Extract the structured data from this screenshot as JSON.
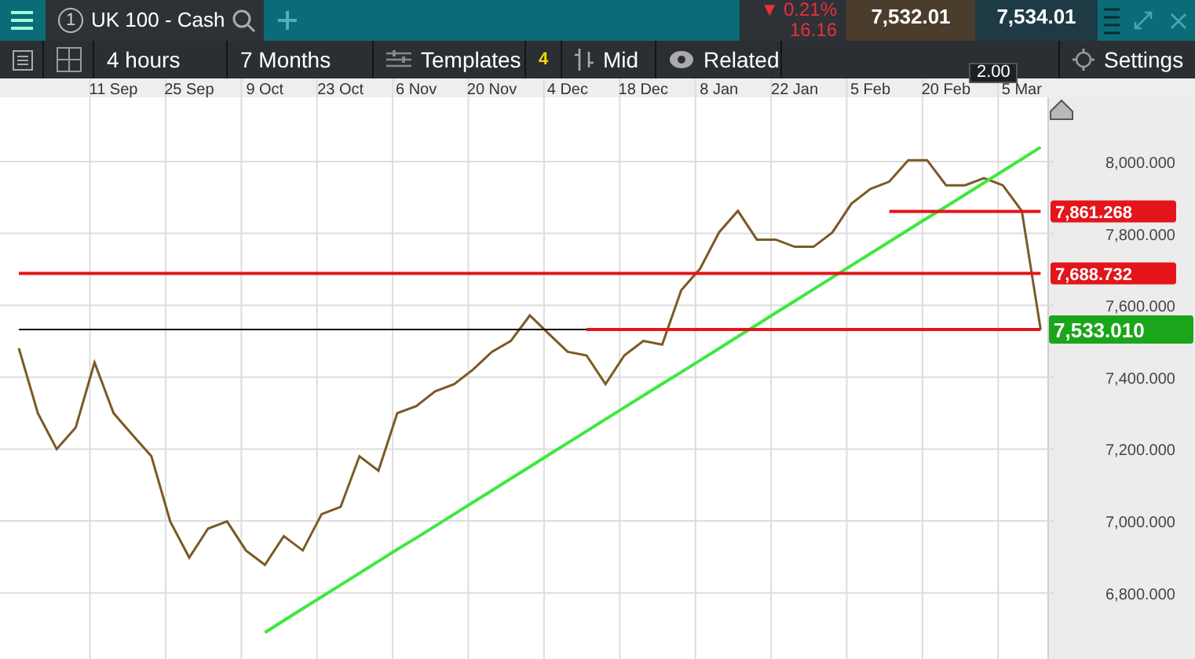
{
  "header": {
    "tab": {
      "number": "1",
      "title": "UK 100 - Cash",
      "selected": true
    },
    "change": {
      "arrow": "▼",
      "percent": "0.21%",
      "points": "16.16"
    },
    "bid": "7,532.01",
    "ask": "7,534.01",
    "spread": "2.00"
  },
  "toolbar": {
    "interval": "4 hours",
    "range": "7 Months",
    "templates": "Templates",
    "templates_count": "4",
    "price_type": "Mid",
    "related": "Related",
    "settings": "Settings"
  },
  "chart": {
    "chart_data": {
      "type": "line",
      "categories": [
        null,
        null,
        null,
        null,
        null,
        "11 Sep",
        null,
        null,
        null,
        "25 Sep",
        null,
        null,
        null,
        "9 Oct",
        null,
        null,
        null,
        "23 Oct",
        null,
        null,
        null,
        "6 Nov",
        null,
        null,
        null,
        "20 Nov",
        null,
        null,
        null,
        "4 Dec",
        null,
        null,
        null,
        "18 Dec",
        null,
        null,
        null,
        "8 Jan",
        null,
        null,
        null,
        "22 Jan",
        null,
        null,
        null,
        "5 Feb",
        null,
        null,
        null,
        "20 Feb",
        null,
        null,
        null,
        "5 Mar",
        null
      ],
      "grid": true,
      "series": [
        {
          "color": "#7a5a24",
          "values": [
            7481,
            7300,
            7200,
            7260,
            7441,
            7300,
            7240,
            7180,
            6999,
            6898,
            6979,
            6999,
            6918,
            6878,
            6958,
            6918,
            7019,
            7039,
            7180,
            7140,
            7300,
            7320,
            7361,
            7381,
            7421,
            7471,
            7501,
            7572,
            7521,
            7471,
            7461,
            7381,
            7461,
            7501,
            7491,
            7642,
            7702,
            7803,
            7863,
            7783,
            7783,
            7763,
            7763,
            7803,
            7883,
            7924,
            7944,
            8004,
            8004,
            7934,
            7934,
            7954,
            7934,
            7863,
            7533
          ]
        },
        {
          "color": "#3ee83e",
          "values": [
            null,
            null,
            null,
            null,
            null,
            null,
            null,
            null,
            null,
            null,
            null,
            null,
            null,
            6690,
            6723,
            6756,
            6789,
            6822,
            6855,
            6888,
            6921,
            6953,
            6986,
            7019,
            7052,
            7085,
            7118,
            7151,
            7184,
            7217,
            7250,
            7283,
            7316,
            7349,
            7382,
            7414,
            7447,
            7480,
            7513,
            7546,
            7579,
            7612,
            7645,
            7678,
            7711,
            7744,
            7777,
            7810,
            7843,
            7875,
            7908,
            7941,
            7974,
            8007,
            8040
          ]
        },
        {
          "color": "#000000",
          "values": [
            7533,
            7533,
            7533,
            7533,
            7533,
            7533,
            7533,
            7533,
            7533,
            7533,
            7533,
            7533,
            7533,
            7533,
            7533,
            7533,
            7533,
            7533,
            7533,
            7533,
            7533,
            7533,
            7533,
            7533,
            7533,
            7533,
            7533,
            7533,
            7533,
            7533,
            7533,
            null,
            null,
            null,
            null,
            null,
            null,
            null,
            null,
            null,
            null,
            null,
            null,
            null,
            null,
            null,
            null,
            null,
            null,
            null,
            null,
            null,
            null,
            null,
            null
          ]
        },
        {
          "color": "#e3151a",
          "values": [
            null,
            null,
            null,
            null,
            null,
            null,
            null,
            null,
            null,
            null,
            null,
            null,
            null,
            null,
            null,
            null,
            null,
            null,
            null,
            null,
            null,
            null,
            null,
            null,
            null,
            null,
            null,
            null,
            null,
            null,
            null,
            null,
            null,
            null,
            null,
            null,
            null,
            null,
            null,
            null,
            null,
            null,
            null,
            null,
            null,
            null,
            7861,
            7861,
            7861,
            7861,
            7861,
            7861,
            7861,
            7861,
            7861
          ]
        },
        {
          "color": "#e3151a",
          "values": [
            7689,
            7689,
            7689,
            7689,
            7689,
            7689,
            7689,
            7689,
            7689,
            7689,
            7689,
            7689,
            7689,
            7689,
            7689,
            7689,
            7689,
            7689,
            7689,
            7689,
            7689,
            7689,
            7689,
            7689,
            7689,
            7689,
            7689,
            7689,
            7689,
            7689,
            7689,
            7689,
            7689,
            7689,
            7689,
            7689,
            7689,
            7689,
            7689,
            7689,
            7689,
            7689,
            7689,
            7689,
            7689,
            7689,
            7689,
            7689,
            7689,
            7689,
            7689,
            7689,
            7689,
            7689,
            7689
          ]
        },
        {
          "color": "#e3151a",
          "values": [
            null,
            null,
            null,
            null,
            null,
            null,
            null,
            null,
            null,
            null,
            null,
            null,
            null,
            null,
            null,
            null,
            null,
            null,
            null,
            null,
            null,
            null,
            null,
            null,
            null,
            null,
            null,
            null,
            null,
            null,
            7533,
            7533,
            7533,
            7533,
            7533,
            7533,
            7533,
            7533,
            7533,
            7533,
            7533,
            7533,
            7533,
            7533,
            7533,
            7533,
            7533,
            7533,
            7533,
            7533,
            7533,
            7533,
            7533,
            7533,
            7533
          ]
        }
      ],
      "ylim": [
        6616,
        8179
      ],
      "yticks": [
        {
          "value": 6800,
          "label": "6,800.000"
        },
        {
          "value": 7000,
          "label": "7,000.000"
        },
        {
          "value": 7200,
          "label": "7,200.000"
        },
        {
          "value": 7400,
          "label": "7,400.000"
        },
        {
          "value": 7600,
          "label": "7,600.000"
        },
        {
          "value": 7800,
          "label": "7,800.000"
        },
        {
          "value": 8000,
          "label": "8,000.000"
        }
      ]
    },
    "overlays": [
      {
        "kind": "hline",
        "label": "7,861.268",
        "color": "#e3151a"
      },
      {
        "kind": "hline",
        "label": "7,688.732",
        "color": "#e3151a"
      },
      {
        "kind": "last-price",
        "label": "7,533.010",
        "color": "#1aa51a"
      }
    ]
  }
}
